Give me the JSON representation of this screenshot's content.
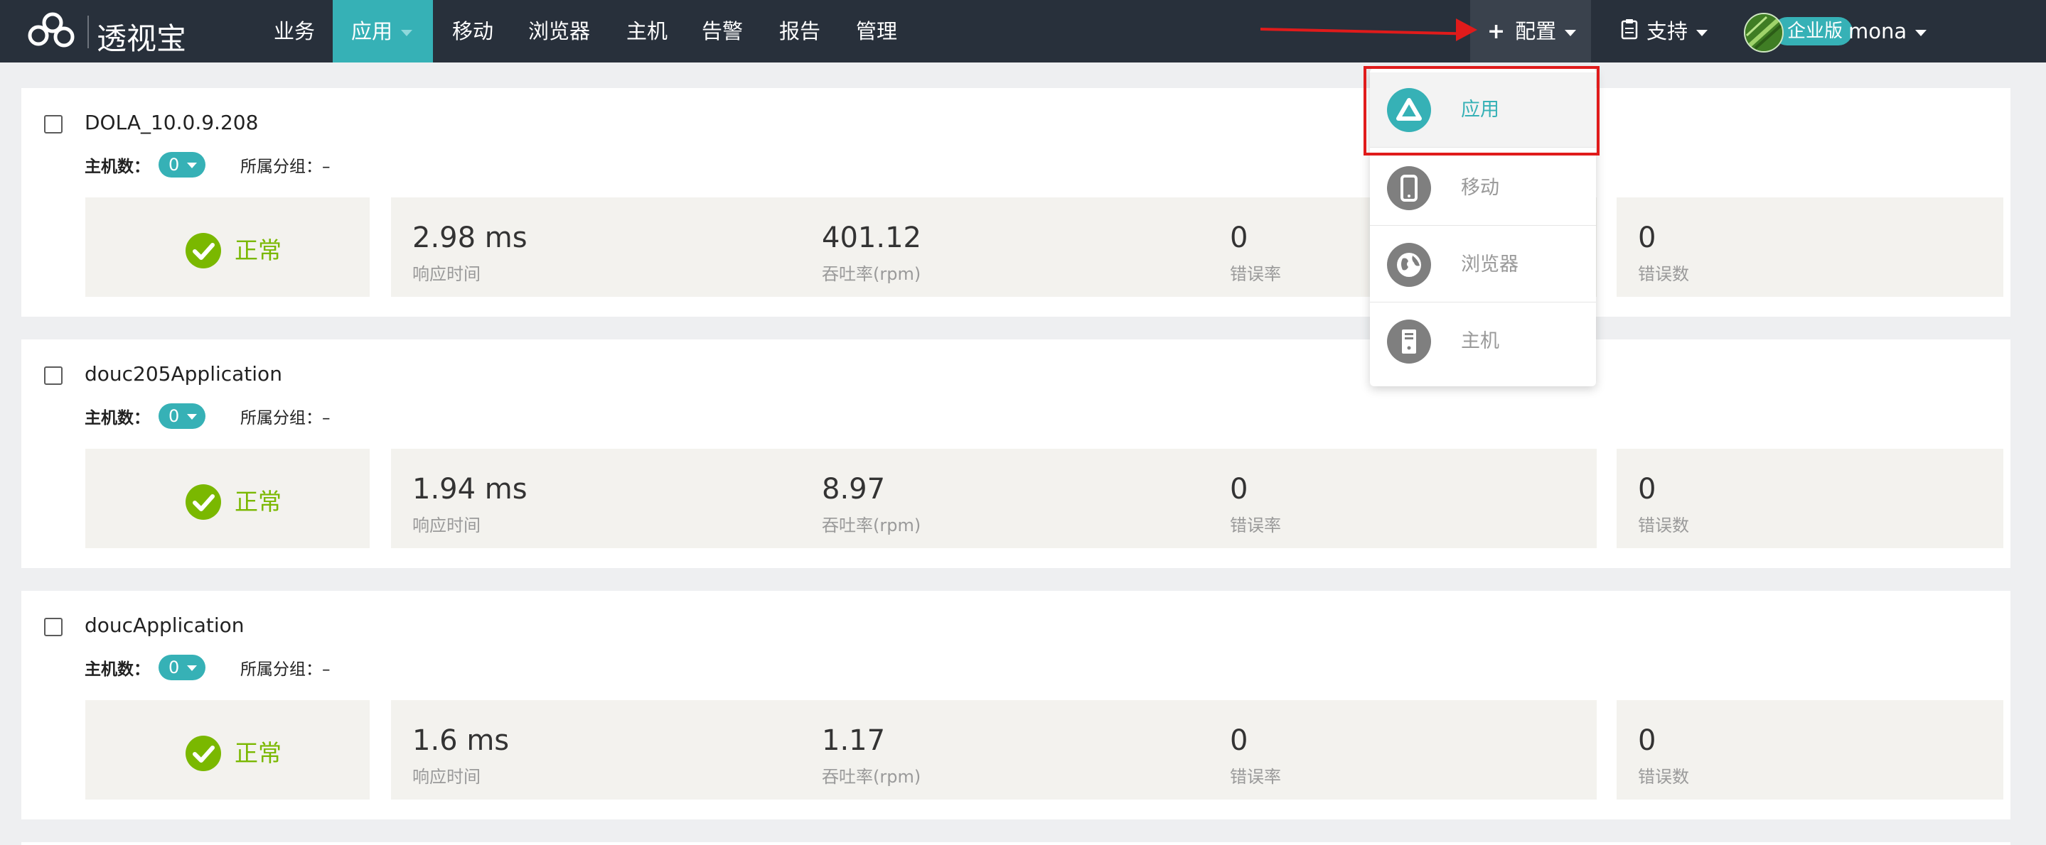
{
  "brand": {
    "name": "透视宝"
  },
  "nav": {
    "items": [
      {
        "label": "业务"
      },
      {
        "label": "应用"
      },
      {
        "label": "移动"
      },
      {
        "label": "浏览器"
      },
      {
        "label": "主机"
      },
      {
        "label": "告警"
      },
      {
        "label": "报告"
      },
      {
        "label": "管理"
      }
    ],
    "active": "应用",
    "config_label": "配置",
    "support_label": "支持",
    "edition_badge": "企业版",
    "username": "mona"
  },
  "config_menu": {
    "items": [
      {
        "label": "应用",
        "icon": "app-icon"
      },
      {
        "label": "移动",
        "icon": "mobile-phone-icon"
      },
      {
        "label": "浏览器",
        "icon": "globe-icon"
      },
      {
        "label": "主机",
        "icon": "server-icon"
      }
    ],
    "highlighted": "应用"
  },
  "apps": [
    {
      "name": "DOLA_10.0.9.208",
      "host_count_label": "主机数：",
      "host_count": "0",
      "group_label": "所属分组：",
      "group_value": "–",
      "status": "正常",
      "response_time": {
        "value": "2.98 ms",
        "label": "响应时间"
      },
      "throughput": {
        "value": "401.12",
        "label": "吞吐率(rpm)"
      },
      "error_rate": {
        "value": "0",
        "label": "错误率"
      },
      "error_count": {
        "value": "0",
        "label": "错误数"
      }
    },
    {
      "name": "douc205Application",
      "host_count_label": "主机数：",
      "host_count": "0",
      "group_label": "所属分组：",
      "group_value": "–",
      "status": "正常",
      "response_time": {
        "value": "1.94 ms",
        "label": "响应时间"
      },
      "throughput": {
        "value": "8.97",
        "label": "吞吐率(rpm)"
      },
      "error_rate": {
        "value": "0",
        "label": "错误率"
      },
      "error_count": {
        "value": "0",
        "label": "错误数"
      }
    },
    {
      "name": "doucApplication",
      "host_count_label": "主机数：",
      "host_count": "0",
      "group_label": "所属分组：",
      "group_value": "–",
      "status": "正常",
      "response_time": {
        "value": "1.6 ms",
        "label": "响应时间"
      },
      "throughput": {
        "value": "1.17",
        "label": "吞吐率(rpm)"
      },
      "error_rate": {
        "value": "0",
        "label": "错误率"
      },
      "error_count": {
        "value": "0",
        "label": "错误数"
      }
    }
  ],
  "colors": {
    "nav_bg": "#28303b",
    "accent": "#36b1b6",
    "status_ok": "#7ab800",
    "annotation_red": "#e01b1b"
  }
}
